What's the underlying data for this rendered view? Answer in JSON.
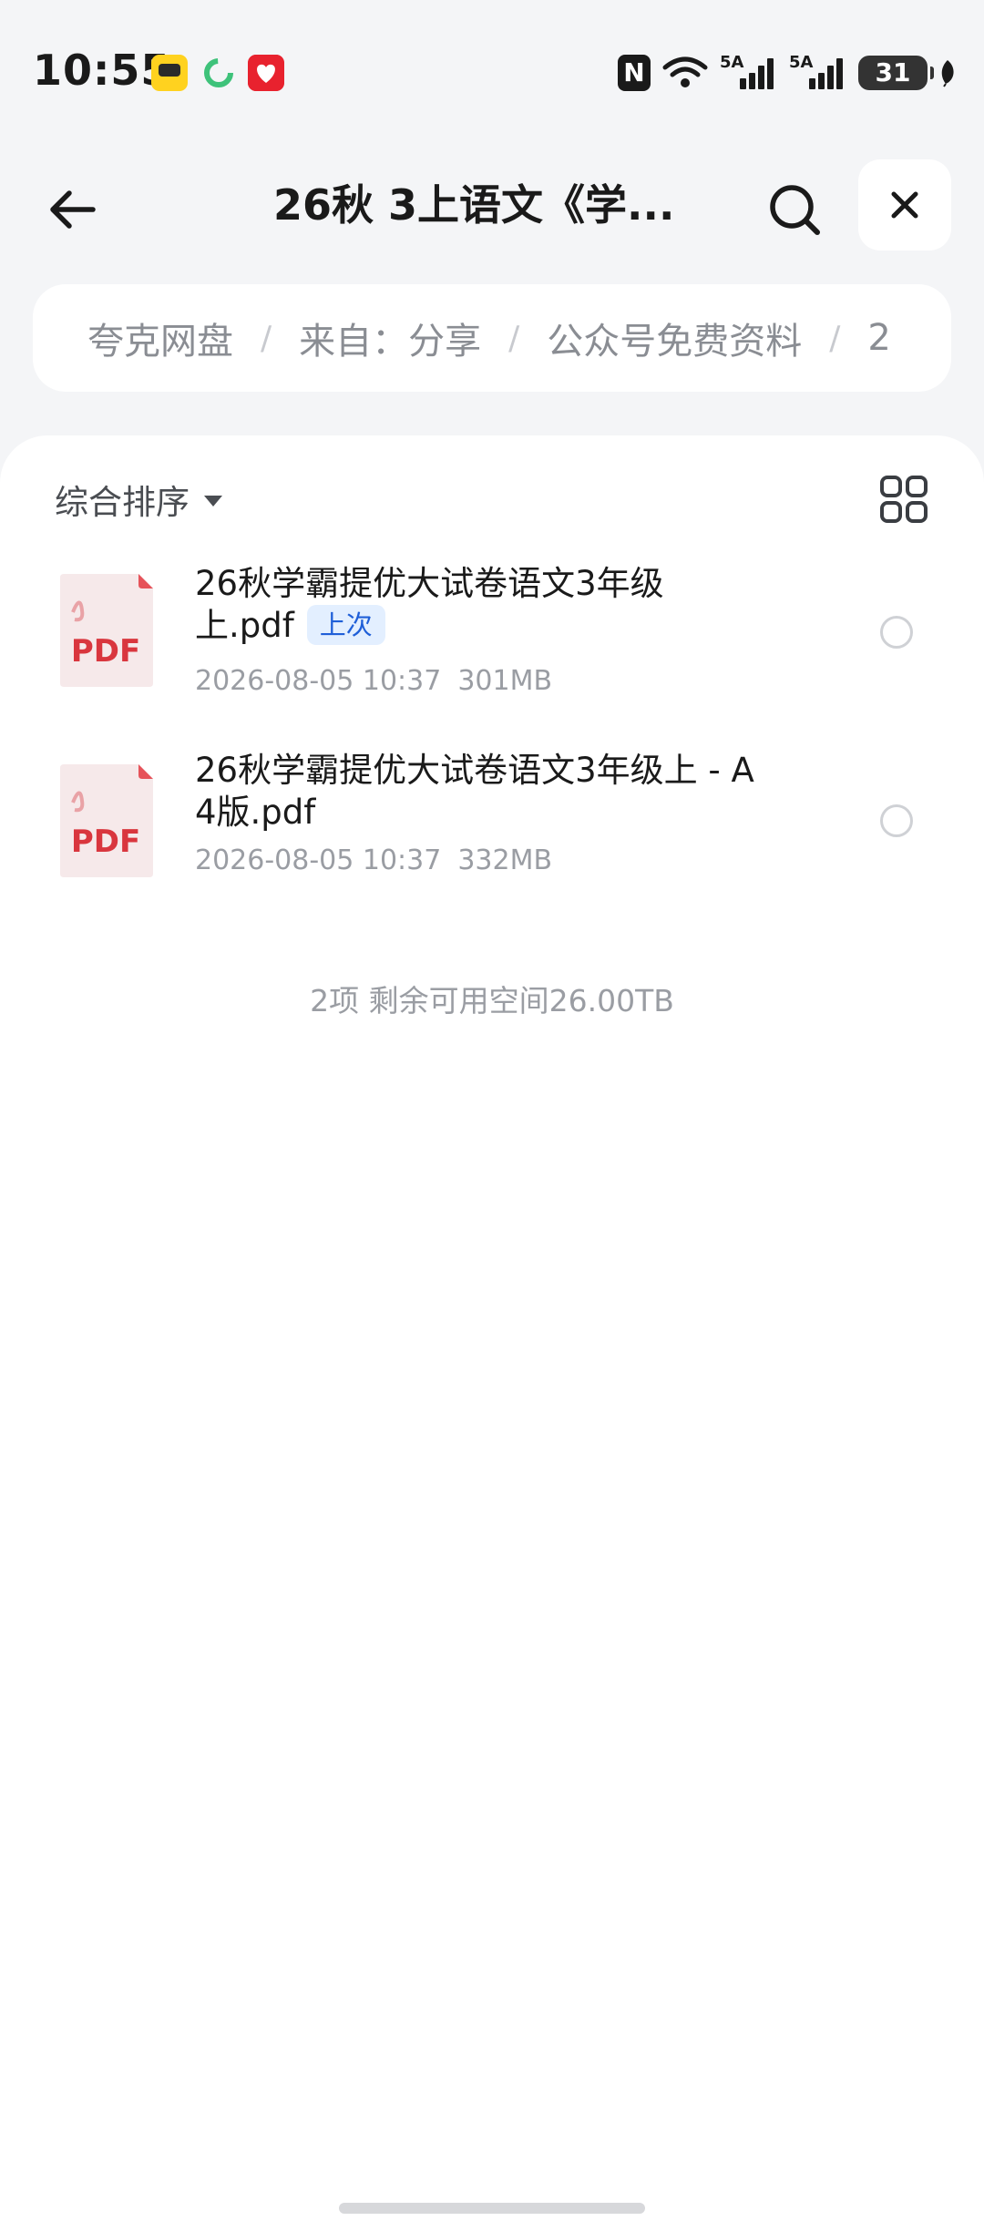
{
  "status_bar": {
    "time": "10:55",
    "nfc_label": "N",
    "signal1_label": "5A",
    "signal2_label": "5A",
    "battery": "31"
  },
  "header": {
    "title": "26秋 3上语文《学...",
    "icons": {
      "back": "arrow-left-icon",
      "search": "search-icon",
      "close": "close-icon"
    }
  },
  "breadcrumb": {
    "items": [
      "夸克网盘",
      "来自：分享",
      "公众号免费资料",
      "2"
    ],
    "separator": "/"
  },
  "toolbar": {
    "sort_label": "综合排序",
    "view_icon": "grid-view-icon"
  },
  "files": [
    {
      "name": "26秋学霸提优大试卷语文3年级上.pdf",
      "name_line1": "26秋学霸提优大试卷语文3年级",
      "name_line2": "上.pdf",
      "badge": "上次",
      "date": "2026-08-05 10:37",
      "size": "301MB",
      "icon_label": "PDF"
    },
    {
      "name": "26秋学霸提优大试卷语文3年级上 - A4版.pdf",
      "name_line1": "26秋学霸提优大试卷语文3年级上 - A",
      "name_line2": "4版.pdf",
      "date": "2026-08-05 10:37",
      "size": "332MB",
      "icon_label": "PDF"
    }
  ],
  "summary": "2项 剩余可用空间26.00TB",
  "colors": {
    "page_bg": "#f4f5f7",
    "panel_bg": "#ffffff",
    "badge_bg": "#e3efff",
    "badge_text": "#1f5fd8",
    "pdf_red": "#d9363e"
  }
}
